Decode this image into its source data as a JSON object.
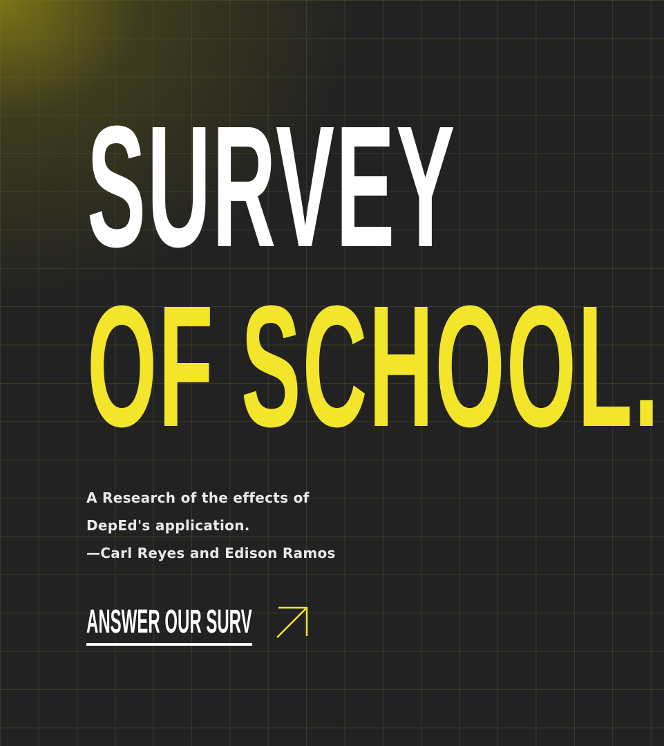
{
  "hero": {
    "title_line1": "SURVEY",
    "title_line2": "OF SCHOOL."
  },
  "description": {
    "line1": "A Research of the effects of",
    "line2": "DepEd's application.",
    "line3": "—Carl Reyes and Edison Ramos"
  },
  "cta": {
    "label": "ANSWER OUR SURVEY NOW",
    "icon": "arrow-up-right-icon"
  },
  "colors": {
    "background": "#222222",
    "accent": "#f2e52a",
    "text": "#ffffff"
  }
}
